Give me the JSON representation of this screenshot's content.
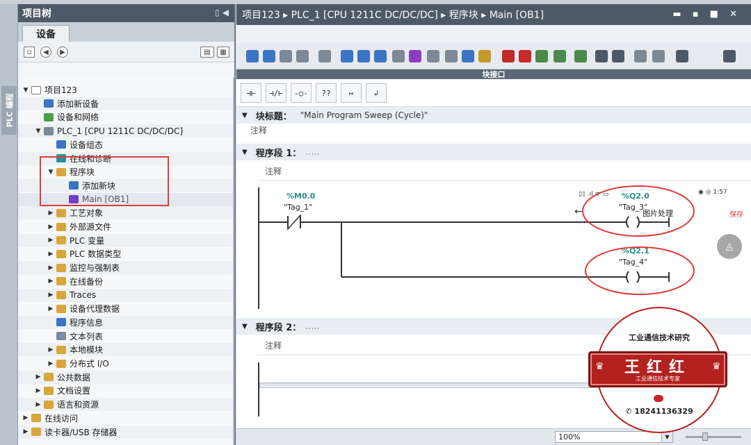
{
  "side_tab": {
    "label": "PLC 编程"
  },
  "project_tree": {
    "title": "项目树",
    "tab": "设备",
    "items": [
      {
        "label": "项目123",
        "level": 0,
        "expanded": true,
        "icon": "document-icon"
      },
      {
        "label": "添加新设备",
        "level": 1,
        "icon": "add-device-icon"
      },
      {
        "label": "设备和网络",
        "level": 1,
        "icon": "network-icon"
      },
      {
        "label": "PLC_1 [CPU 1211C DC/DC/DC]",
        "level": 1,
        "expanded": true,
        "icon": "cpu-icon"
      },
      {
        "label": "设备组态",
        "level": 2,
        "icon": "device-config-icon"
      },
      {
        "label": "在线和诊断",
        "level": 2,
        "icon": "diagnostics-icon"
      },
      {
        "label": "程序块",
        "level": 2,
        "expanded": true,
        "icon": "folder-icon"
      },
      {
        "label": "添加新块",
        "level": 3,
        "icon": "add-block-icon"
      },
      {
        "label": "Main [OB1]",
        "level": 3,
        "icon": "ob-block-icon"
      },
      {
        "label": "工艺对象",
        "level": 2,
        "expanded": false,
        "icon": "folder-icon"
      },
      {
        "label": "外部源文件",
        "level": 2,
        "expanded": false,
        "icon": "folder-icon"
      },
      {
        "label": "PLC 变量",
        "level": 2,
        "expanded": false,
        "icon": "folder-icon"
      },
      {
        "label": "PLC 数据类型",
        "level": 2,
        "expanded": false,
        "icon": "folder-icon"
      },
      {
        "label": "监控与强制表",
        "level": 2,
        "expanded": false,
        "icon": "folder-icon"
      },
      {
        "label": "在线备份",
        "level": 2,
        "expanded": false,
        "icon": "folder-icon"
      },
      {
        "label": "Traces",
        "level": 2,
        "expanded": false,
        "icon": "folder-icon"
      },
      {
        "label": "设备代理数据",
        "level": 2,
        "expanded": false,
        "icon": "folder-icon"
      },
      {
        "label": "程序信息",
        "level": 2,
        "icon": "program-info-icon"
      },
      {
        "label": "文本列表",
        "level": 2,
        "icon": "text-list-icon"
      },
      {
        "label": "本地模块",
        "level": 2,
        "expanded": false,
        "icon": "folder-icon"
      },
      {
        "label": "分布式 I/O",
        "level": 2,
        "expanded": false,
        "icon": "folder-icon"
      },
      {
        "label": "公共数据",
        "level": 1,
        "expanded": false,
        "icon": "folder-icon"
      },
      {
        "label": "文档设置",
        "level": 1,
        "expanded": false,
        "icon": "folder-icon"
      },
      {
        "label": "语言和资源",
        "level": 1,
        "expanded": false,
        "icon": "folder-icon"
      },
      {
        "label": "在线访问",
        "level": 0,
        "expanded": false,
        "icon": "folder-icon"
      },
      {
        "label": "读卡器/USB 存储器",
        "level": 0,
        "expanded": false,
        "icon": "folder-icon"
      }
    ]
  },
  "editor": {
    "breadcrumb": [
      "项目123",
      "PLC_1 [CPU 1211C DC/DC/DC]",
      "程序块",
      "Main [OB1]"
    ],
    "interface_label": "块接口",
    "lad_elements": [
      "⊣⊢",
      "⊣/⊢",
      "-○-",
      "??",
      "↦",
      "↲"
    ],
    "block_title": {
      "label": "块标题：",
      "value": "\"Main Program Sweep (Cycle)\"",
      "comment": "注释"
    },
    "networks": [
      {
        "title": "程序段 1：",
        "placeholder": ".....",
        "comment": "注释",
        "contact": {
          "address": "%M0.0",
          "tag": "\"Tag_1\"",
          "type": "normally-closed"
        },
        "coils": [
          {
            "address": "%Q2.0",
            "tag": "\"Tag_3\""
          },
          {
            "address": "%Q2.1",
            "tag": "\"Tag_4\""
          }
        ]
      },
      {
        "title": "程序段 2：",
        "placeholder": ".....",
        "comment": "注释"
      }
    ]
  },
  "status_bar": {
    "zoom": "100%"
  },
  "phone_overlay": {
    "status_left": "▯▯ .ıl ᯤ ▭",
    "status_right": "◉ ◎ 1:57",
    "title": "图片处理",
    "save": "保存"
  },
  "stamp": {
    "top_text": "工业通信技术研究",
    "name": "王红红",
    "subtitle": "工业通信技术专家",
    "phone": "18241136329",
    "color": "#b3221f"
  },
  "colors": {
    "title_bar": "#4d5966",
    "highlight_red": "#e03a3a",
    "address_teal": "#2a8f86",
    "rung_line": "#333333"
  }
}
